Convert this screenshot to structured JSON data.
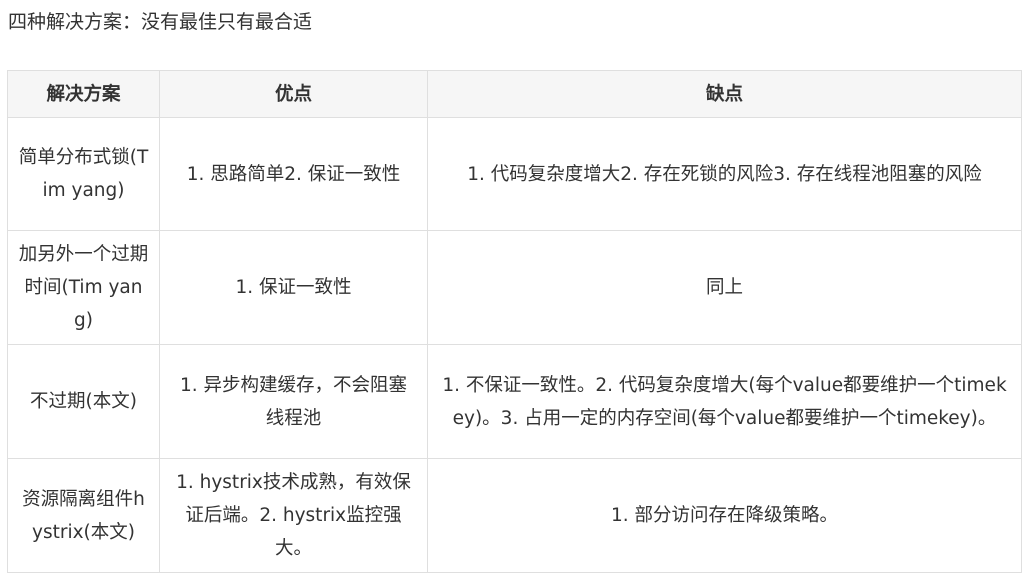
{
  "intro": "四种解决方案：没有最佳只有最合适",
  "table": {
    "headers": [
      "解决方案",
      "优点",
      "缺点"
    ],
    "rows": [
      {
        "solution": "简单分布式锁(Tim yang)",
        "pros": "1. 思路简单2. 保证一致性",
        "cons": "1. 代码复杂度增大2. 存在死锁的风险3. 存在线程池阻塞的风险"
      },
      {
        "solution": "加另外一个过期时间(Tim yang)",
        "pros": "1. 保证一致性",
        "cons": "同上"
      },
      {
        "solution": "不过期(本文)",
        "pros": "1. 异步构建缓存，不会阻塞线程池",
        "cons": "1. 不保证一致性。2. 代码复杂度增大(每个value都要维护一个timekey)。3. 占用一定的内存空间(每个value都要维护一个timekey)。"
      },
      {
        "solution": "资源隔离组件hystrix(本文)",
        "pros": "1. hystrix技术成熟，有效保证后端。2. hystrix监控强大。",
        "cons": "1. 部分访问存在降级策略。"
      }
    ]
  }
}
